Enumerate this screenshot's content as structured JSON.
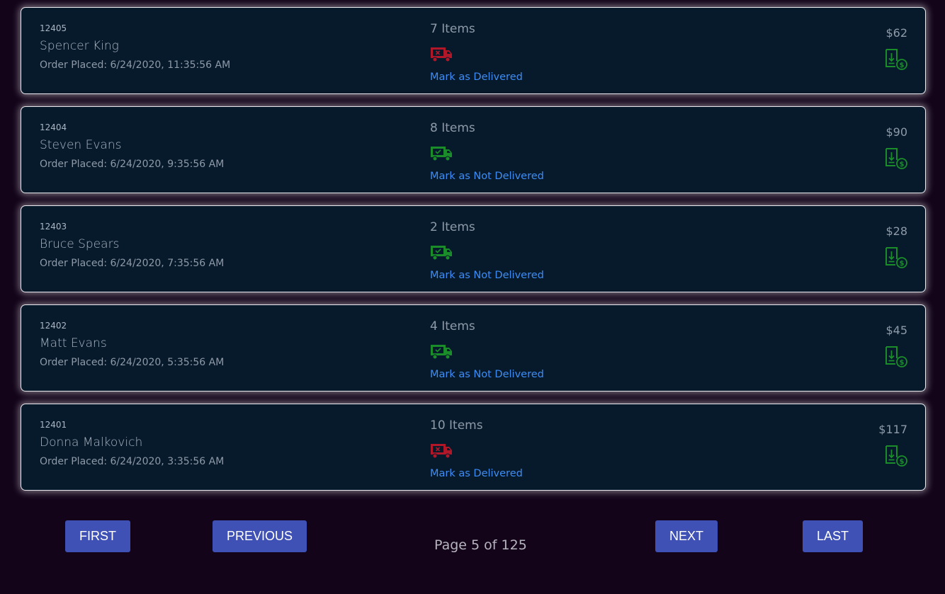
{
  "orders": [
    {
      "id": "12405",
      "name": "Spencer King",
      "placed": "Order Placed: 6/24/2020, 11:35:56 AM",
      "items": "7 Items",
      "delivered": false,
      "action": "Mark as Delivered",
      "price": "$62"
    },
    {
      "id": "12404",
      "name": "Steven Evans",
      "placed": "Order Placed: 6/24/2020, 9:35:56 AM",
      "items": "8 Items",
      "delivered": true,
      "action": "Mark as Not Delivered",
      "price": "$90"
    },
    {
      "id": "12403",
      "name": "Bruce Spears",
      "placed": "Order Placed: 6/24/2020, 7:35:56 AM",
      "items": "2 Items",
      "delivered": true,
      "action": "Mark as Not Delivered",
      "price": "$28"
    },
    {
      "id": "12402",
      "name": "Matt Evans",
      "placed": "Order Placed: 6/24/2020, 5:35:56 AM",
      "items": "4 Items",
      "delivered": true,
      "action": "Mark as Not Delivered",
      "price": "$45"
    },
    {
      "id": "12401",
      "name": "Donna Malkovich",
      "placed": "Order Placed: 6/24/2020, 3:35:56 AM",
      "items": "10 Items",
      "delivered": false,
      "action": "Mark as Delivered",
      "price": "$117"
    }
  ],
  "pagination": {
    "first": "FIRST",
    "previous": "PREVIOUS",
    "next": "NEXT",
    "last": "LAST",
    "page": "Page 5 of 125"
  },
  "colors": {
    "background": "#13041a",
    "card": "#071a2c",
    "delivered": "#1a8c2a",
    "not_delivered": "#b0182a",
    "link": "#3d8df5",
    "button": "#3f51b5"
  },
  "icons": {
    "delivered": "truck-check-icon",
    "not_delivered": "truck-x-icon",
    "invoice": "invoice-download-icon"
  }
}
